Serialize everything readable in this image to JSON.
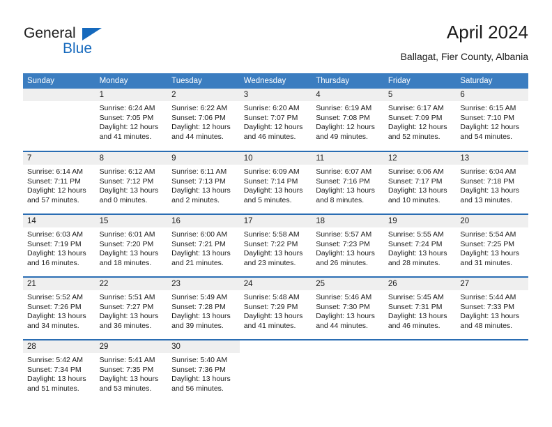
{
  "brand": {
    "name_part1": "General",
    "name_part2": "Blue",
    "mark": "triangle-logo"
  },
  "header": {
    "title": "April 2024",
    "location": "Ballagat, Fier County, Albania"
  },
  "calendar": {
    "weekday_headers": [
      "Sunday",
      "Monday",
      "Tuesday",
      "Wednesday",
      "Thursday",
      "Friday",
      "Saturday"
    ],
    "colors": {
      "header_bg": "#3b7dc0",
      "header_text": "#ffffff",
      "row_separator": "#2a6db3",
      "daynum_band_bg": "#efefef",
      "brand_blue": "#1569bd",
      "text": "#1b1b1b"
    },
    "weeks": [
      [
        {
          "day": "",
          "lines": []
        },
        {
          "day": "1",
          "lines": [
            "Sunrise: 6:24 AM",
            "Sunset: 7:05 PM",
            "Daylight: 12 hours",
            "and 41 minutes."
          ]
        },
        {
          "day": "2",
          "lines": [
            "Sunrise: 6:22 AM",
            "Sunset: 7:06 PM",
            "Daylight: 12 hours",
            "and 44 minutes."
          ]
        },
        {
          "day": "3",
          "lines": [
            "Sunrise: 6:20 AM",
            "Sunset: 7:07 PM",
            "Daylight: 12 hours",
            "and 46 minutes."
          ]
        },
        {
          "day": "4",
          "lines": [
            "Sunrise: 6:19 AM",
            "Sunset: 7:08 PM",
            "Daylight: 12 hours",
            "and 49 minutes."
          ]
        },
        {
          "day": "5",
          "lines": [
            "Sunrise: 6:17 AM",
            "Sunset: 7:09 PM",
            "Daylight: 12 hours",
            "and 52 minutes."
          ]
        },
        {
          "day": "6",
          "lines": [
            "Sunrise: 6:15 AM",
            "Sunset: 7:10 PM",
            "Daylight: 12 hours",
            "and 54 minutes."
          ]
        }
      ],
      [
        {
          "day": "7",
          "lines": [
            "Sunrise: 6:14 AM",
            "Sunset: 7:11 PM",
            "Daylight: 12 hours",
            "and 57 minutes."
          ]
        },
        {
          "day": "8",
          "lines": [
            "Sunrise: 6:12 AM",
            "Sunset: 7:12 PM",
            "Daylight: 13 hours",
            "and 0 minutes."
          ]
        },
        {
          "day": "9",
          "lines": [
            "Sunrise: 6:11 AM",
            "Sunset: 7:13 PM",
            "Daylight: 13 hours",
            "and 2 minutes."
          ]
        },
        {
          "day": "10",
          "lines": [
            "Sunrise: 6:09 AM",
            "Sunset: 7:14 PM",
            "Daylight: 13 hours",
            "and 5 minutes."
          ]
        },
        {
          "day": "11",
          "lines": [
            "Sunrise: 6:07 AM",
            "Sunset: 7:16 PM",
            "Daylight: 13 hours",
            "and 8 minutes."
          ]
        },
        {
          "day": "12",
          "lines": [
            "Sunrise: 6:06 AM",
            "Sunset: 7:17 PM",
            "Daylight: 13 hours",
            "and 10 minutes."
          ]
        },
        {
          "day": "13",
          "lines": [
            "Sunrise: 6:04 AM",
            "Sunset: 7:18 PM",
            "Daylight: 13 hours",
            "and 13 minutes."
          ]
        }
      ],
      [
        {
          "day": "14",
          "lines": [
            "Sunrise: 6:03 AM",
            "Sunset: 7:19 PM",
            "Daylight: 13 hours",
            "and 16 minutes."
          ]
        },
        {
          "day": "15",
          "lines": [
            "Sunrise: 6:01 AM",
            "Sunset: 7:20 PM",
            "Daylight: 13 hours",
            "and 18 minutes."
          ]
        },
        {
          "day": "16",
          "lines": [
            "Sunrise: 6:00 AM",
            "Sunset: 7:21 PM",
            "Daylight: 13 hours",
            "and 21 minutes."
          ]
        },
        {
          "day": "17",
          "lines": [
            "Sunrise: 5:58 AM",
            "Sunset: 7:22 PM",
            "Daylight: 13 hours",
            "and 23 minutes."
          ]
        },
        {
          "day": "18",
          "lines": [
            "Sunrise: 5:57 AM",
            "Sunset: 7:23 PM",
            "Daylight: 13 hours",
            "and 26 minutes."
          ]
        },
        {
          "day": "19",
          "lines": [
            "Sunrise: 5:55 AM",
            "Sunset: 7:24 PM",
            "Daylight: 13 hours",
            "and 28 minutes."
          ]
        },
        {
          "day": "20",
          "lines": [
            "Sunrise: 5:54 AM",
            "Sunset: 7:25 PM",
            "Daylight: 13 hours",
            "and 31 minutes."
          ]
        }
      ],
      [
        {
          "day": "21",
          "lines": [
            "Sunrise: 5:52 AM",
            "Sunset: 7:26 PM",
            "Daylight: 13 hours",
            "and 34 minutes."
          ]
        },
        {
          "day": "22",
          "lines": [
            "Sunrise: 5:51 AM",
            "Sunset: 7:27 PM",
            "Daylight: 13 hours",
            "and 36 minutes."
          ]
        },
        {
          "day": "23",
          "lines": [
            "Sunrise: 5:49 AM",
            "Sunset: 7:28 PM",
            "Daylight: 13 hours",
            "and 39 minutes."
          ]
        },
        {
          "day": "24",
          "lines": [
            "Sunrise: 5:48 AM",
            "Sunset: 7:29 PM",
            "Daylight: 13 hours",
            "and 41 minutes."
          ]
        },
        {
          "day": "25",
          "lines": [
            "Sunrise: 5:46 AM",
            "Sunset: 7:30 PM",
            "Daylight: 13 hours",
            "and 44 minutes."
          ]
        },
        {
          "day": "26",
          "lines": [
            "Sunrise: 5:45 AM",
            "Sunset: 7:31 PM",
            "Daylight: 13 hours",
            "and 46 minutes."
          ]
        },
        {
          "day": "27",
          "lines": [
            "Sunrise: 5:44 AM",
            "Sunset: 7:33 PM",
            "Daylight: 13 hours",
            "and 48 minutes."
          ]
        }
      ],
      [
        {
          "day": "28",
          "lines": [
            "Sunrise: 5:42 AM",
            "Sunset: 7:34 PM",
            "Daylight: 13 hours",
            "and 51 minutes."
          ]
        },
        {
          "day": "29",
          "lines": [
            "Sunrise: 5:41 AM",
            "Sunset: 7:35 PM",
            "Daylight: 13 hours",
            "and 53 minutes."
          ]
        },
        {
          "day": "30",
          "lines": [
            "Sunrise: 5:40 AM",
            "Sunset: 7:36 PM",
            "Daylight: 13 hours",
            "and 56 minutes."
          ]
        },
        {
          "day": "",
          "lines": []
        },
        {
          "day": "",
          "lines": []
        },
        {
          "day": "",
          "lines": []
        },
        {
          "day": "",
          "lines": []
        }
      ]
    ]
  }
}
